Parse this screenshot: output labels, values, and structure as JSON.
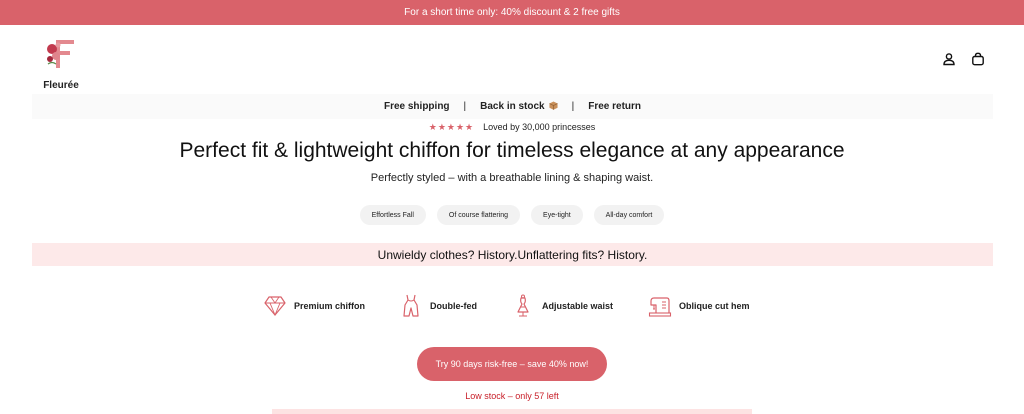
{
  "announcement": "For a short time only: 40% discount & 2 free gifts",
  "brand": {
    "name": "Fleurée",
    "accent": "#d9626a"
  },
  "header_icons": [
    "user-icon",
    "shopping-bag-icon"
  ],
  "usp": {
    "shipping": "Free shipping",
    "separator_1": "|",
    "stock": "Back in stock",
    "separator_2": "|",
    "returns": "Free return"
  },
  "rating": {
    "stars": "★★★★★",
    "text": "Loved by 30,000 princesses"
  },
  "headline": "Perfect fit & lightweight chiffon for timeless elegance at any appearance",
  "subline": "Perfectly styled – with a breathable lining & shaping waist.",
  "chips": [
    "Effortless Fall",
    "Of course flattering",
    "Eye-tight",
    "All-day comfort"
  ],
  "pain_banner": "Unwieldy clothes? History.Unflattering fits? History.",
  "features": [
    {
      "icon": "diamond-icon",
      "label": "Premium chiffon"
    },
    {
      "icon": "dress-icon",
      "label": "Double-fed"
    },
    {
      "icon": "dress-form-icon",
      "label": "Adjustable waist"
    },
    {
      "icon": "sewing-machine-icon",
      "label": "Oblique cut hem"
    }
  ],
  "cta": "Try 90 days risk-free – save 40% now!",
  "stock_note": "Low stock – only 57 left",
  "colors": {
    "announcement_bg": "#d9626a",
    "pain_bg": "#fde9e9",
    "stock_text": "#c8202a"
  }
}
